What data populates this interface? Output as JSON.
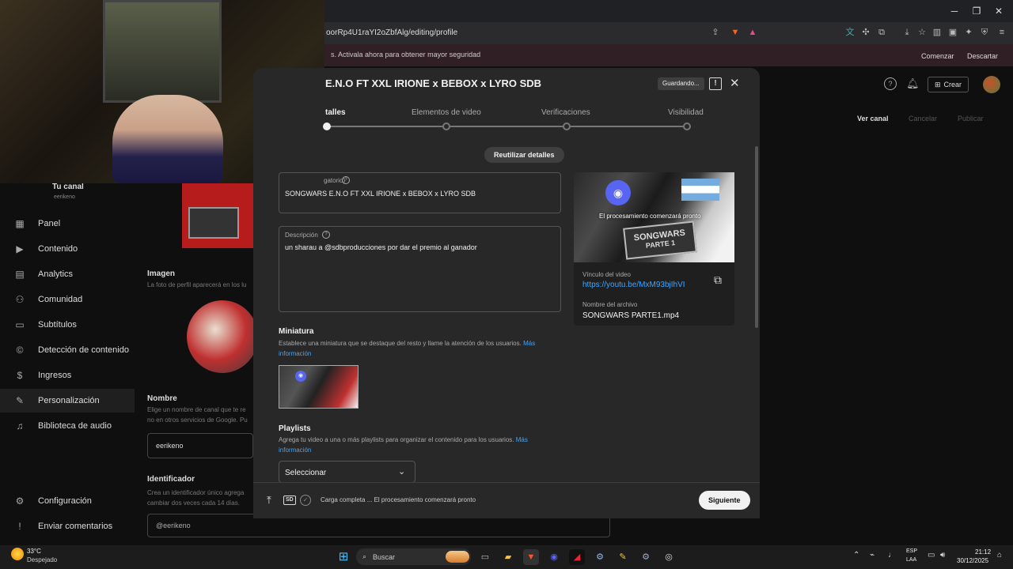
{
  "browser": {
    "url": "oorRp4U1raYI2oZbfAlg/editing/profile",
    "infobar_text": "s. Activala ahora para obtener mayor seguridad",
    "infobar_buttons": [
      "Comenzar",
      "Descartar"
    ]
  },
  "yt_header": {
    "create_label": "Crear"
  },
  "studio": {
    "channel_name": "Tu canal",
    "channel_handle": "eerikeno",
    "sidebar_items": [
      "Panel",
      "Contenido",
      "Analytics",
      "Comunidad",
      "Subtítulos",
      "Detección de contenido",
      "Ingresos",
      "Personalización",
      "Biblioteca de audio"
    ],
    "sidebar_bottom": [
      "Configuración",
      "Enviar comentarios"
    ],
    "actions": [
      "Ver canal",
      "Cancelar",
      "Publicar"
    ],
    "image_label": "Imagen",
    "image_desc": "La foto de perfil aparecerá en los lu",
    "name_label": "Nombre",
    "name_desc_1": "Elige un nombre de canal que te re",
    "name_desc_2": "no en otros servicios de Google. Pu",
    "name_value": "eerikeno",
    "handle_label": "Identificador",
    "handle_desc_1": "Crea un identificador único agrega",
    "handle_desc_2": "cambiar dos veces cada 14 días.",
    "handle_value": "@eerikeno"
  },
  "dialog": {
    "title": "E.N.O FT XXL IRIONE x BEBOX x LYRO SDB",
    "saving": "Guardando...",
    "steps": [
      "talles",
      "Elementos de video",
      "Verificaciones",
      "Visibilidad"
    ],
    "reuse_button": "Reutilizar detalles",
    "title_field_label": "gatorio)",
    "title_value": "SONGWARS E.N.O FT XXL IRIONE x BEBOX x LYRO SDB",
    "description_label": "Descripción",
    "description_value": "un sharau a @sdbproducciones por dar el premio al ganador",
    "thumbnail_heading": "Miniatura",
    "thumbnail_desc": "Establece una miniatura que se destaque del resto y llame la atención de los usuarios.",
    "thumbnail_link_1": "Más",
    "thumbnail_link_2": "información",
    "playlists_heading": "Playlists",
    "playlists_desc": "Agrega tu video a una o más playlists para organizar el contenido para los usuarios.",
    "playlists_link_1": "Más",
    "playlists_link_2": "información",
    "playlist_select": "Seleccionar",
    "preview_overlay": "El procesamiento comenzará pronto",
    "preview_thumb_text_1": "SONGWARS",
    "preview_thumb_text_2": "PARTE 1",
    "video_link_label": "Vínculo del video",
    "video_link": "https://youtu.be/MxM93bjIhVI",
    "filename_label": "Nombre del archivo",
    "filename": "SONGWARS PARTE1.mp4",
    "status_text": "Carga completa ... El procesamiento comenzará pronto",
    "status_badge": "SD",
    "next_button": "Siguiente"
  },
  "taskbar": {
    "weather_temp": "33°C",
    "weather_desc": "Despejado",
    "search_label": "Buscar",
    "lang_1": "ESP",
    "lang_2": "LAA",
    "time": "21:12",
    "date": "30/12/2025"
  },
  "colors": {
    "accent_link": "#3ea6ff",
    "dialog_bg": "#282828",
    "page_bg": "#0f0f0f"
  }
}
